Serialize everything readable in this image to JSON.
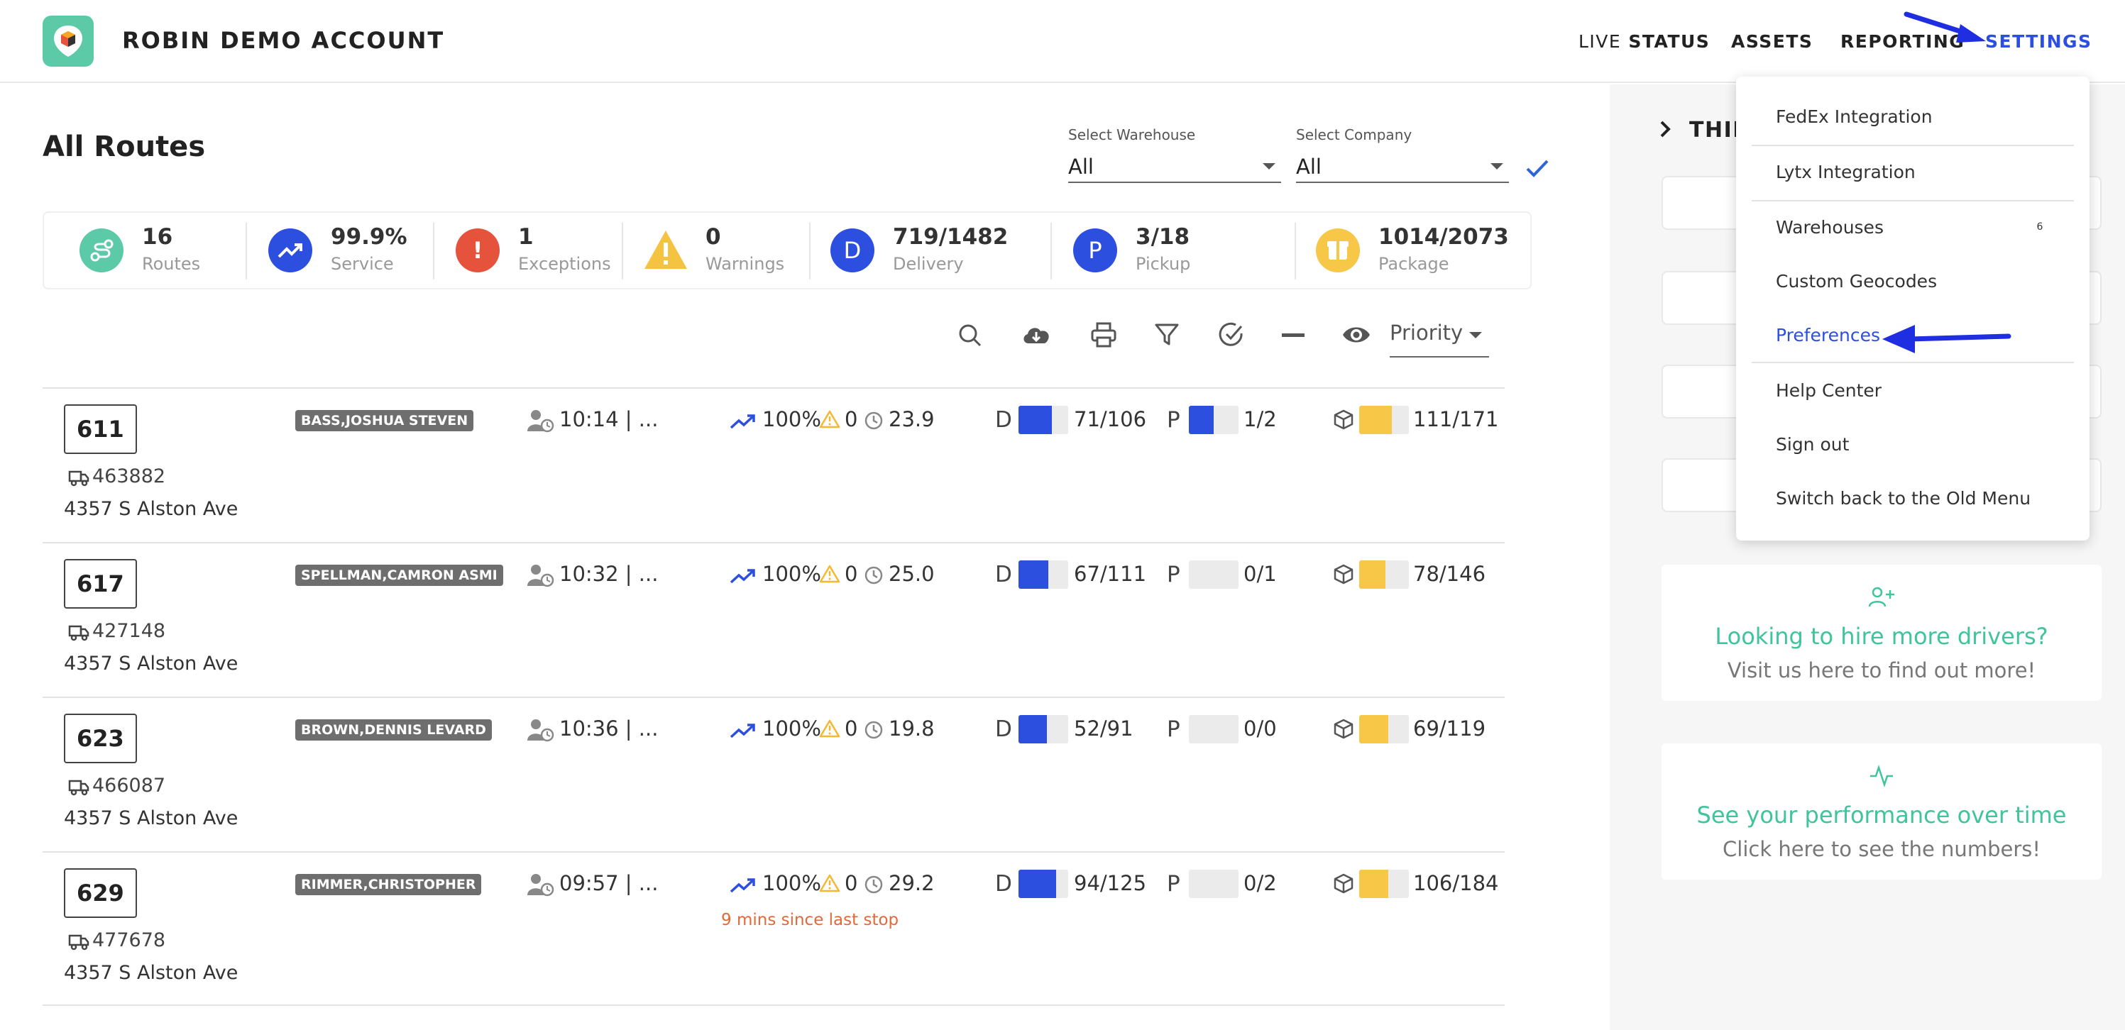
{
  "header": {
    "account_name": "ROBIN DEMO ACCOUNT",
    "nav": {
      "live_prefix": "LIVE",
      "live_suffix": "STATUS",
      "assets": "ASSETS",
      "reporting": "REPORTING",
      "settings": "SETTINGS"
    }
  },
  "page": {
    "title": "All Routes",
    "warehouse_label": "Select Warehouse",
    "warehouse_value": "All",
    "company_label": "Select Company",
    "company_value": "All"
  },
  "stats": {
    "routes": {
      "value": "16",
      "label": "Routes"
    },
    "service": {
      "value": "99.9%",
      "label": "Service"
    },
    "exceptions": {
      "value": "1",
      "label": "Exceptions",
      "icon_text": "!"
    },
    "warnings": {
      "value": "0",
      "label": "Warnings"
    },
    "delivery": {
      "value": "719/1482",
      "label": "Delivery",
      "icon_text": "D"
    },
    "pickup": {
      "value": "3/18",
      "label": "Pickup",
      "icon_text": "P"
    },
    "package": {
      "value": "1014/2073",
      "label": "Package"
    }
  },
  "toolbar": {
    "priority": "Priority"
  },
  "routes": [
    {
      "number": "611",
      "vehicle": "463882",
      "address": "4357 S Alston Ave",
      "driver": "BASS,JOSHUA STEVEN",
      "start": "10:14 | ...",
      "service": "100%",
      "warnings": "0",
      "elapsed": "23.9",
      "d_label": "D",
      "delivery": "71/106",
      "delivery_frac": 0.67,
      "p_label": "P",
      "pickup": "1/2",
      "pickup_frac": 0.5,
      "package": "111/171",
      "package_frac": 0.65,
      "note": ""
    },
    {
      "number": "617",
      "vehicle": "427148",
      "address": "4357 S Alston Ave",
      "driver": "SPELLMAN,CAMRON ASMI",
      "start": "10:32 | ...",
      "service": "100%",
      "warnings": "0",
      "elapsed": "25.0",
      "d_label": "D",
      "delivery": "67/111",
      "delivery_frac": 0.6,
      "p_label": "P",
      "pickup": "0/1",
      "pickup_frac": 0,
      "package": "78/146",
      "package_frac": 0.53,
      "note": ""
    },
    {
      "number": "623",
      "vehicle": "466087",
      "address": "4357 S Alston Ave",
      "driver": "BROWN,DENNIS LEVARD",
      "start": "10:36 | ...",
      "service": "100%",
      "warnings": "0",
      "elapsed": "19.8",
      "d_label": "D",
      "delivery": "52/91",
      "delivery_frac": 0.57,
      "p_label": "P",
      "pickup": "0/0",
      "pickup_frac": 0,
      "package": "69/119",
      "package_frac": 0.58,
      "note": ""
    },
    {
      "number": "629",
      "vehicle": "477678",
      "address": "4357 S Alston Ave",
      "driver": "RIMMER,CHRISTOPHER",
      "start": "09:57 | ...",
      "service": "100%",
      "warnings": "0",
      "elapsed": "29.2",
      "d_label": "D",
      "delivery": "94/125",
      "delivery_frac": 0.75,
      "p_label": "P",
      "pickup": "0/2",
      "pickup_frac": 0,
      "package": "106/184",
      "package_frac": 0.58,
      "note": "9 mins since last stop"
    }
  ],
  "settings_menu": {
    "items": [
      "FedEx Integration",
      "Lytx Integration",
      "Warehouses",
      "Custom Geocodes",
      "Preferences",
      "Help Center",
      "Sign out",
      "Switch back to the Old Menu"
    ],
    "warehouses_badge": "6"
  },
  "right_panel": {
    "section_title": "THIN",
    "hire_title": "Looking to hire more drivers?",
    "hire_sub": "Visit us here to find out more!",
    "perf_title": "See your performance over time",
    "perf_sub": "Click here to see the numbers!"
  },
  "colors": {
    "accent_blue": "#2d4fe0",
    "teal": "#5cc9a7",
    "danger": "#e5533d",
    "warning": "#f5c342",
    "package_yellow": "#f7c748",
    "driver_chip": "#6e6e6e"
  },
  "icons": [
    "route-icon",
    "trend-up-icon",
    "exclamation-icon",
    "warning-triangle-icon",
    "download-cloud-icon",
    "print-icon",
    "filter-icon",
    "check-circle-icon",
    "minus-icon",
    "eye-icon",
    "search-icon",
    "truck-icon",
    "person-clock-icon",
    "clock-icon",
    "package-icon",
    "user-plus-icon",
    "activity-icon",
    "chevron-right-icon",
    "annotation-arrow-icon"
  ]
}
